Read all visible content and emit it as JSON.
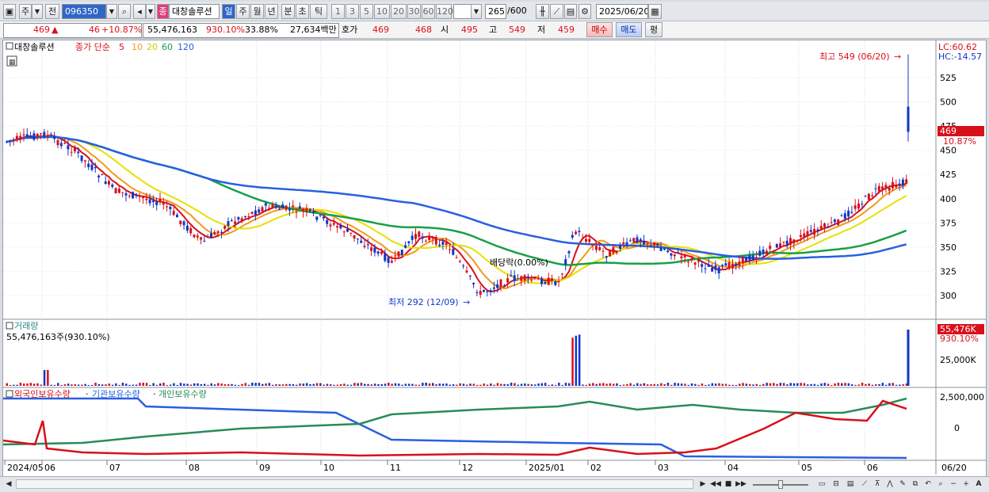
{
  "toolbar": {
    "market": "주",
    "period_type": "전",
    "code": "096350",
    "stock_name": "대창솔루션",
    "name_badge": "종",
    "periods": [
      "일",
      "주",
      "월",
      "년",
      "분",
      "초",
      "틱"
    ],
    "intervals": [
      "1",
      "3",
      "5",
      "10",
      "20",
      "30",
      "60",
      "120"
    ],
    "count": "265",
    "count_total": "/600",
    "date": "2025/06/20"
  },
  "quote": {
    "price": "469",
    "arrow": "▲",
    "change": "46",
    "change_pct": "+10.87%",
    "volume": "55,476,163",
    "volume_ratio": "930.10%",
    "turnover": "33.88%",
    "amount": "27,634백만",
    "ask_label": "호가",
    "ask": "469",
    "bid": "468",
    "open_label": "시",
    "open": "495",
    "high_label": "고",
    "high": "549",
    "low_label": "저",
    "low": "459",
    "buy_label": "매수",
    "sell_label": "매도",
    "eval_label": "평"
  },
  "price_panel": {
    "stock_label": "대창솔루션",
    "ma_title": "종가 단순",
    "ma_periods": [
      "5",
      "10",
      "20",
      "60",
      "120"
    ],
    "ma_colors": [
      "#d8101a",
      "#f09a1a",
      "#e8e000",
      "#18a048",
      "#2860e0"
    ],
    "high_note": "최고 549 (06/20)",
    "low_note": "최저 292 (12/09)",
    "dividend_note": "배당락(0.00%)",
    "lc": "LC:60.62",
    "hc": "HC:-14.57",
    "price_tag": "469",
    "pct_tag": "10.87%",
    "y_ticks": [
      "525",
      "500",
      "475",
      "450",
      "425",
      "400",
      "375",
      "350",
      "325",
      "300"
    ]
  },
  "volume_panel": {
    "title": "거래량",
    "value": "55,476,163주(930.10%)",
    "tag_value": "55,476K",
    "tag_pct": "930.10%",
    "y_tick": "25,000K"
  },
  "holding_panel": {
    "series_names": [
      "외국인보유수량",
      "기관보유수량",
      "개인보유수량"
    ],
    "series_colors": [
      "#d8101a",
      "#2860e0",
      "#2a8a5a"
    ],
    "y_ticks": [
      "2,500,000",
      "0"
    ]
  },
  "x_axis": {
    "labels": [
      "2024/05",
      "06",
      "07",
      "08",
      "09",
      "10",
      "11",
      "12",
      "2025/01",
      "02",
      "03",
      "04",
      "05",
      "06"
    ],
    "end_label": "06/20"
  },
  "colors": {
    "up": "#d8101a",
    "down": "#1036c8",
    "accent": "#2f66c8"
  }
}
